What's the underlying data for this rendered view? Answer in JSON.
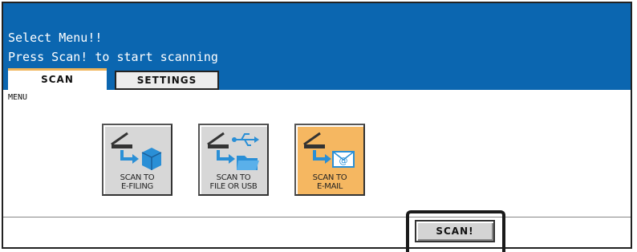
{
  "header": {
    "line1": "Select Menu!!",
    "line2": "Press Scan! to start scanning",
    "color": "#0b66b0"
  },
  "tabs": [
    {
      "label": "SCAN",
      "active": true
    },
    {
      "label": "SETTINGS",
      "active": false
    }
  ],
  "menu_label": "MENU",
  "tiles": [
    {
      "line1": "SCAN TO",
      "line2": "E-FILING",
      "icon": "scanner-to-cube-icon",
      "selected": false
    },
    {
      "line1": "SCAN TO",
      "line2": "FILE OR USB",
      "icon": "scanner-to-folder-usb-icon",
      "selected": false
    },
    {
      "line1": "SCAN TO",
      "line2": "E-MAIL",
      "icon": "scanner-to-email-icon",
      "selected": true
    }
  ],
  "scan_button": {
    "label": "SCAN!"
  },
  "colors": {
    "accent": "#f5b761",
    "tab_indicator": "#f0b45a",
    "icon_blue": "#2a8fd6"
  }
}
